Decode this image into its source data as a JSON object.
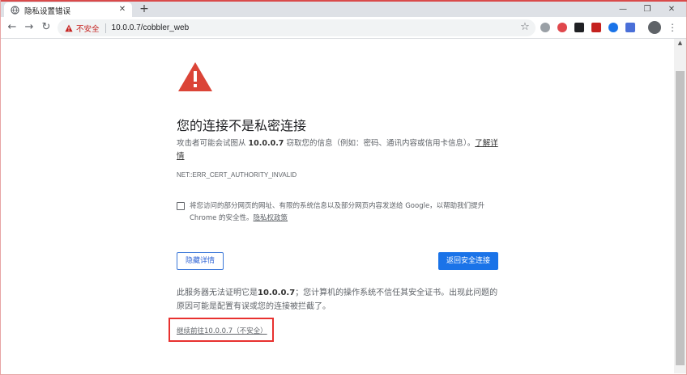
{
  "browser": {
    "tab": {
      "title": "隐私设置错误",
      "close_label": "✕"
    },
    "new_tab_label": "+",
    "window_controls": {
      "minimize": "—",
      "maximize": "❐",
      "close": "✕"
    },
    "nav": {
      "back": "←",
      "forward": "→",
      "reload": "↻"
    },
    "omnibox": {
      "security_label": "不安全",
      "url": "10.0.0.7/cobbler_web"
    },
    "star_label": "☆",
    "menu_label": "⋮"
  },
  "colors": {
    "accent": "#1a73e8",
    "danger": "#d93025",
    "highlight_box": "#e8312f"
  },
  "page": {
    "heading": "您的连接不是私密连接",
    "desc_before": "攻击者可能会试图从 ",
    "desc_host": "10.0.0.7",
    "desc_after": " 窃取您的信息（例如：密码、通讯内容或信用卡信息）。",
    "learn_more": "了解详情",
    "error_code": "NET::ERR_CERT_AUTHORITY_INVALID",
    "optin_text": "将您访问的部分网页的网址、有限的系统信息以及部分网页内容发送给 Google，以帮助我们提升 Chrome 的安全性。",
    "privacy_link": "隐私权政策",
    "details_button": "隐藏详情",
    "back_button": "返回安全连接",
    "explain_before": "此服务器无法证明它是",
    "explain_host": "10.0.0.7",
    "explain_after": "；您计算机的操作系统不信任其安全证书。出现此问题的原因可能是配置有误或您的连接被拦截了。",
    "proceed_link": "继续前往10.0.0.7（不安全）"
  }
}
